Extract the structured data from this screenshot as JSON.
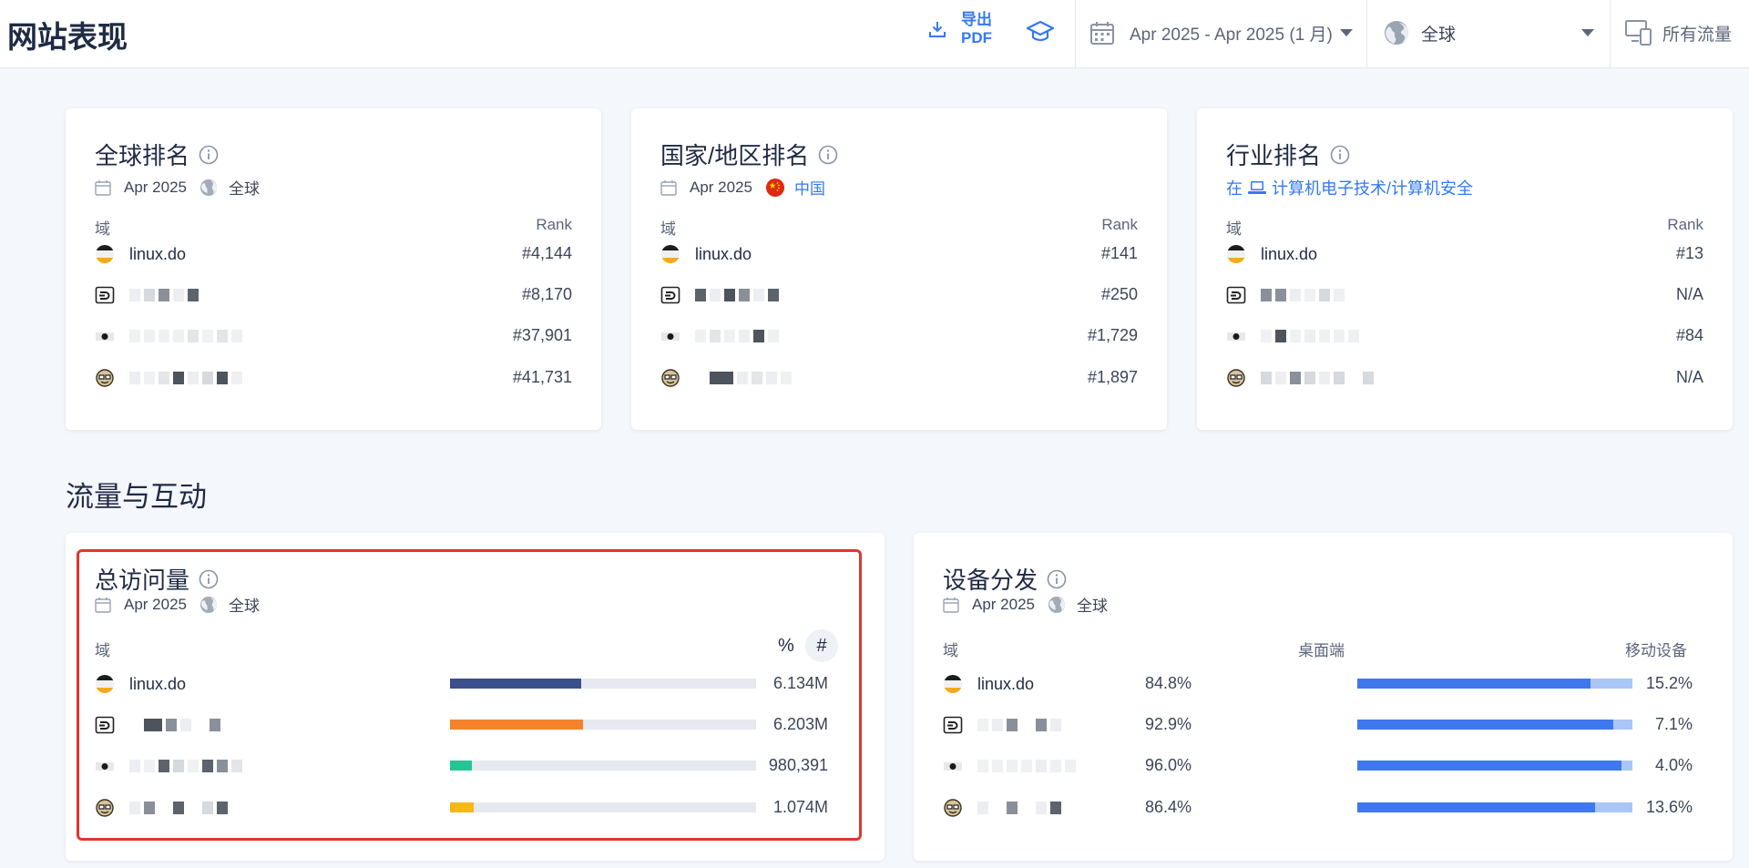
{
  "header": {
    "title": "网站表现",
    "export_label_line1": "导出",
    "export_label_line2": "PDF",
    "date_range": "Apr 2025 - Apr 2025 (1 月)",
    "geo": "全球",
    "traffic": "所有流量"
  },
  "global_rank": {
    "title": "全球排名",
    "date": "Apr 2025",
    "geo": "全球",
    "col_domain": "域",
    "col_rank": "Rank",
    "rows": [
      {
        "name": "linux.do",
        "rank": "#4,144"
      },
      {
        "name": "",
        "rank": "#8,170"
      },
      {
        "name": "",
        "rank": "#37,901"
      },
      {
        "name": "",
        "rank": "#41,731"
      }
    ]
  },
  "country_rank": {
    "title": "国家/地区排名",
    "date": "Apr 2025",
    "country": "中国",
    "col_domain": "域",
    "col_rank": "Rank",
    "rows": [
      {
        "name": "linux.do",
        "rank": "#141"
      },
      {
        "name": "",
        "rank": "#250"
      },
      {
        "name": "",
        "rank": "#1,729"
      },
      {
        "name": "",
        "rank": "#1,897"
      }
    ]
  },
  "industry_rank": {
    "title": "行业排名",
    "prefix": "在",
    "category": "计算机电子技术/计算机安全",
    "col_domain": "域",
    "col_rank": "Rank",
    "rows": [
      {
        "name": "linux.do",
        "rank": "#13"
      },
      {
        "name": "",
        "rank": "N/A"
      },
      {
        "name": "",
        "rank": "#84"
      },
      {
        "name": "",
        "rank": "N/A"
      }
    ]
  },
  "section": {
    "title": "流量与互动"
  },
  "total_visits": {
    "title": "总访问量",
    "date": "Apr 2025",
    "geo": "全球",
    "col_domain": "域",
    "pct_label": "%",
    "hash_label": "#",
    "rows": [
      {
        "name": "linux.do",
        "value": "6.134M",
        "share": 0.43,
        "color": "#3a4f8c"
      },
      {
        "name": "",
        "value": "6.203M",
        "share": 0.435,
        "color": "#f5822b"
      },
      {
        "name": "",
        "value": "980,391",
        "share": 0.07,
        "color": "#25c495"
      },
      {
        "name": "",
        "value": "1.074M",
        "share": 0.077,
        "color": "#f6b819"
      }
    ]
  },
  "device": {
    "title": "设备分发",
    "date": "Apr 2025",
    "geo": "全球",
    "col_domain": "域",
    "col_desktop": "桌面端",
    "col_mobile": "移动设备",
    "desktop_color": "#3f78ee",
    "mobile_color": "#a9c6f7",
    "rows": [
      {
        "name": "linux.do",
        "desktop": "84.8%",
        "mobile": "15.2%",
        "desktop_share": 0.848
      },
      {
        "name": "",
        "desktop": "92.9%",
        "mobile": "7.1%",
        "desktop_share": 0.929
      },
      {
        "name": "",
        "desktop": "96.0%",
        "mobile": "4.0%",
        "desktop_share": 0.96
      },
      {
        "name": "",
        "desktop": "86.4%",
        "mobile": "13.6%",
        "desktop_share": 0.864
      }
    ]
  }
}
